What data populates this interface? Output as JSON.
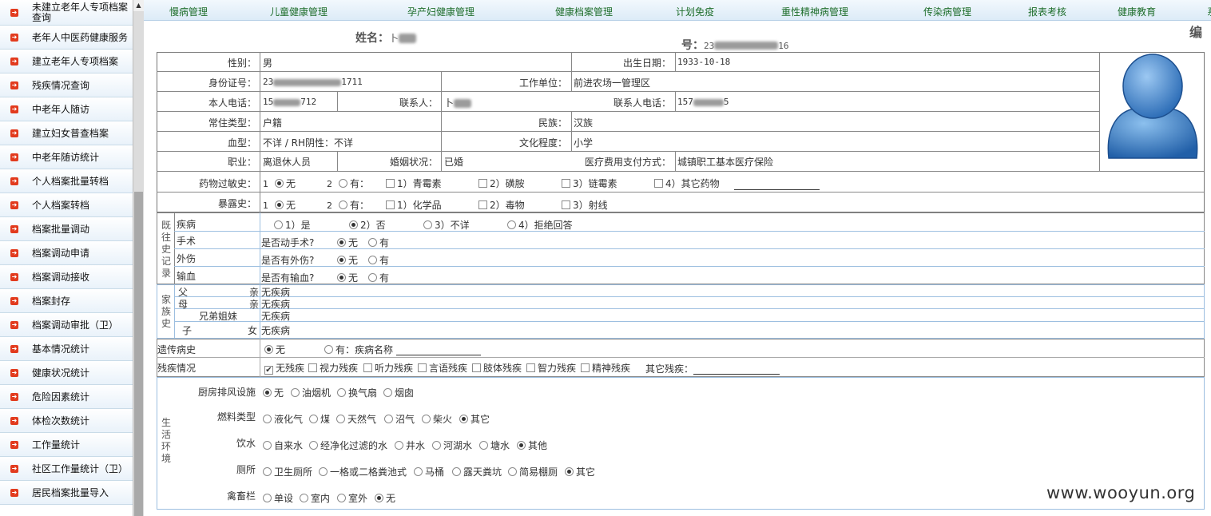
{
  "sidebar": {
    "items": [
      {
        "label": "未建立老年人专项档案查询"
      },
      {
        "label": "老年人中医药健康服务"
      },
      {
        "label": "建立老年人专项档案"
      },
      {
        "label": "残疾情况查询"
      },
      {
        "label": "中老年人随访"
      },
      {
        "label": "建立妇女普查档案"
      },
      {
        "label": "中老年随访统计"
      },
      {
        "label": "个人档案批量转档"
      },
      {
        "label": "个人档案转档"
      },
      {
        "label": "档案批量调动"
      },
      {
        "label": "档案调动申请"
      },
      {
        "label": "档案调动接收"
      },
      {
        "label": "档案封存"
      },
      {
        "label": "档案调动审批（卫）"
      },
      {
        "label": "基本情况统计"
      },
      {
        "label": "健康状况统计"
      },
      {
        "label": "危险因素统计"
      },
      {
        "label": "体检次数统计"
      },
      {
        "label": "工作量统计"
      },
      {
        "label": "社区工作量统计（卫）"
      },
      {
        "label": "居民档案批量导入"
      }
    ]
  },
  "nav": {
    "items": [
      {
        "label": "慢病管理"
      },
      {
        "label": "儿童健康管理"
      },
      {
        "label": "孕产妇健康管理"
      },
      {
        "label": "健康档案管理"
      },
      {
        "label": "计划免疫"
      },
      {
        "label": "重性精神病管理"
      },
      {
        "label": "传染病管理"
      },
      {
        "label": "报表考核"
      },
      {
        "label": "健康教育"
      },
      {
        "label": "系"
      }
    ]
  },
  "header": {
    "name_label": "姓名：",
    "name_prefix": "卜",
    "number_label": "号：",
    "number_prefix": "23",
    "number_suffix": "16",
    "edit_label": "编"
  },
  "basic": {
    "gender_label": "性别：",
    "gender": "男",
    "birth_label": "出生日期：",
    "birth": "1933-10-18",
    "id_label": "身份证号：",
    "id_prefix": "23",
    "id_suffix": "1711",
    "work_label": "工作单位：",
    "work": "前进农场一管理区",
    "phone_label": "本人电话：",
    "phone_prefix": "15",
    "phone_suffix": "712",
    "contact_label": "联系人：",
    "contact_prefix": "卜",
    "contact_phone_label": "联系人电话：",
    "contact_phone_prefix": "157",
    "contact_phone_suffix": "5",
    "residence_label": "常住类型：",
    "residence": "户籍",
    "ethnic_label": "民族：",
    "ethnic": "汉族",
    "blood_label": "血型：",
    "blood": "不详 / RH阴性：不详",
    "edu_label": "文化程度：",
    "edu": "小学",
    "job_label": "职业：",
    "job": "离退休人员",
    "marriage_label": "婚姻状况：",
    "marriage": "已婚",
    "pay_label": "医疗费用支付方式：",
    "pay": "城镇职工基本医疗保险"
  },
  "allergy": {
    "label": "药物过敏史：",
    "opt1_num": "1",
    "opt1": "无",
    "opt2_num": "2",
    "opt2": "有：",
    "c1": "1）青霉素",
    "c2": "2）磺胺",
    "c3": "3）链霉素",
    "c4": "4）其它药物"
  },
  "exposure": {
    "label": "暴露史：",
    "opt1_num": "1",
    "opt1": "无",
    "opt2_num": "2",
    "opt2": "有：",
    "c1": "1）化学品",
    "c2": "2）毒物",
    "c3": "3）射线"
  },
  "history": {
    "section": "既往史记录",
    "disease_label": "疾病",
    "disease_opts": [
      "1）是",
      "2）否",
      "3）不详",
      "4）拒绝回答"
    ],
    "surgery_label": "手术",
    "surgery_q": "是否动手术?",
    "injury_label": "外伤",
    "injury_q": "是否有外伤?",
    "transfusion_label": "输血",
    "transfusion_q": "是否有输血?",
    "no": "无",
    "yes": "有"
  },
  "family": {
    "section": "家族史",
    "father_a": "父",
    "father_b": "亲",
    "father": "无疾病",
    "mother_a": "母",
    "mother_b": "亲",
    "mother": "无疾病",
    "sibling_label": "兄弟姐妹",
    "sibling": "无疾病",
    "child_a": "子",
    "child_b": "女",
    "child": "无疾病"
  },
  "genetic": {
    "label": "遗传病史",
    "opt1": "无",
    "opt2": "有：疾病名称"
  },
  "disability": {
    "label": "残疾情况",
    "opts": [
      "无残疾",
      "视力残疾",
      "听力残疾",
      "言语残疾",
      "肢体残疾",
      "智力残疾",
      "精神残疾"
    ],
    "other": "其它残疾："
  },
  "environment": {
    "section": "生活环境",
    "kitchen_label": "厨房排风设施",
    "kitchen_opts": [
      "无",
      "油烟机",
      "换气扇",
      "烟囱"
    ],
    "fuel_label": "燃料类型",
    "fuel_opts": [
      "液化气",
      "煤",
      "天然气",
      "沼气",
      "柴火",
      "其它"
    ],
    "water_label": "饮水",
    "water_opts": [
      "自来水",
      "经净化过滤的水",
      "井水",
      "河湖水",
      "塘水",
      "其他"
    ],
    "toilet_label": "厕所",
    "toilet_opts": [
      "卫生厕所",
      "一格或二格粪池式",
      "马桶",
      "露天粪坑",
      "简易棚厕",
      "其它"
    ],
    "livestock_label": "禽畜栏",
    "livestock_opts": [
      "单设",
      "室内",
      "室外",
      "无"
    ]
  },
  "watermark": "www.wooyun.org"
}
